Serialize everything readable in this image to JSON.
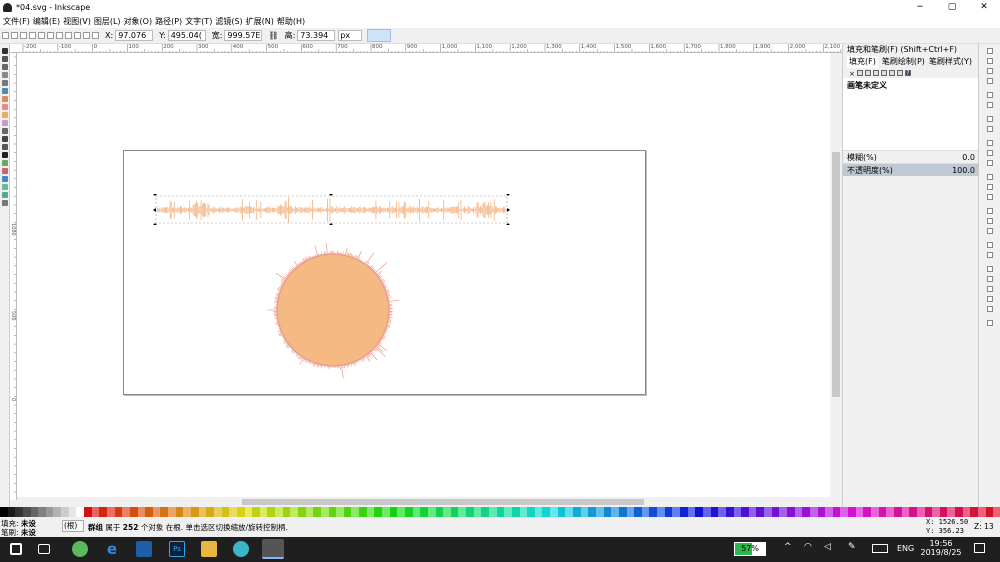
{
  "window": {
    "title": "*04.svg - Inkscape",
    "minimize_glyph": "−",
    "restore_glyph": "▢",
    "close_glyph": "✕"
  },
  "menu": [
    "文件(F)",
    "编辑(E)",
    "视图(V)",
    "图层(L)",
    "对象(O)",
    "路径(P)",
    "文字(T)",
    "滤镜(S)",
    "扩展(N)",
    "帮助(H)"
  ],
  "toolctrl": {
    "x_label": "X:",
    "x_value": "97.076",
    "y_label": "Y:",
    "y_value": "495.04(",
    "w_label": "宽:",
    "w_value": "999.57E",
    "h_label": "高:",
    "h_value": "73.394",
    "unit": "px"
  },
  "rulers": {
    "h_ticks": [
      "-200",
      "-100",
      "0",
      "100",
      "200",
      "300",
      "400",
      "500",
      "600",
      "700",
      "800",
      "900",
      "1,000",
      "1,100",
      "1,200",
      "1,300",
      "1,400",
      "1,500",
      "1,600",
      "1,700",
      "1,800",
      "1,900",
      "2,000",
      "2,100"
    ],
    "v_ticks": [
      "1000",
      "500",
      "0"
    ]
  },
  "dock": {
    "header": "填充和笔刷(F) (Shift+Ctrl+F)",
    "tabs": [
      "填充(F)",
      "笔刷绘制(P)",
      "笔刷样式(Y)"
    ],
    "paint_status": "画笔未定义",
    "blur_label": "模糊(%)",
    "blur_value": "0.0",
    "opacity_label": "不透明度(%)",
    "opacity_value": "100.0"
  },
  "status": {
    "fill_label": "填充:",
    "fill_value": "未设",
    "stroke_label": "笔刷:",
    "stroke_value": "未设",
    "layer_select": "(根)",
    "message_strong": "群组",
    "message_mid": " 属于 ",
    "message_count": "252",
    "message_rest": " 个对象 在根. 单击选区切换缩放/旋转控制柄.",
    "x_label": "X:",
    "x_coord": "1526.50",
    "y_label": "Y:",
    "y_coord": "356.23",
    "zoom_label": "Z:",
    "zoom_value": "13"
  },
  "taskbar": {
    "battery": "57%",
    "lang": "ENG",
    "time": "19:56",
    "date": "2019/8/25"
  },
  "colors": {
    "accent": "#f5b27f",
    "selection_blue": "#cfe3fb",
    "taskbar": "#1f1f1f"
  }
}
